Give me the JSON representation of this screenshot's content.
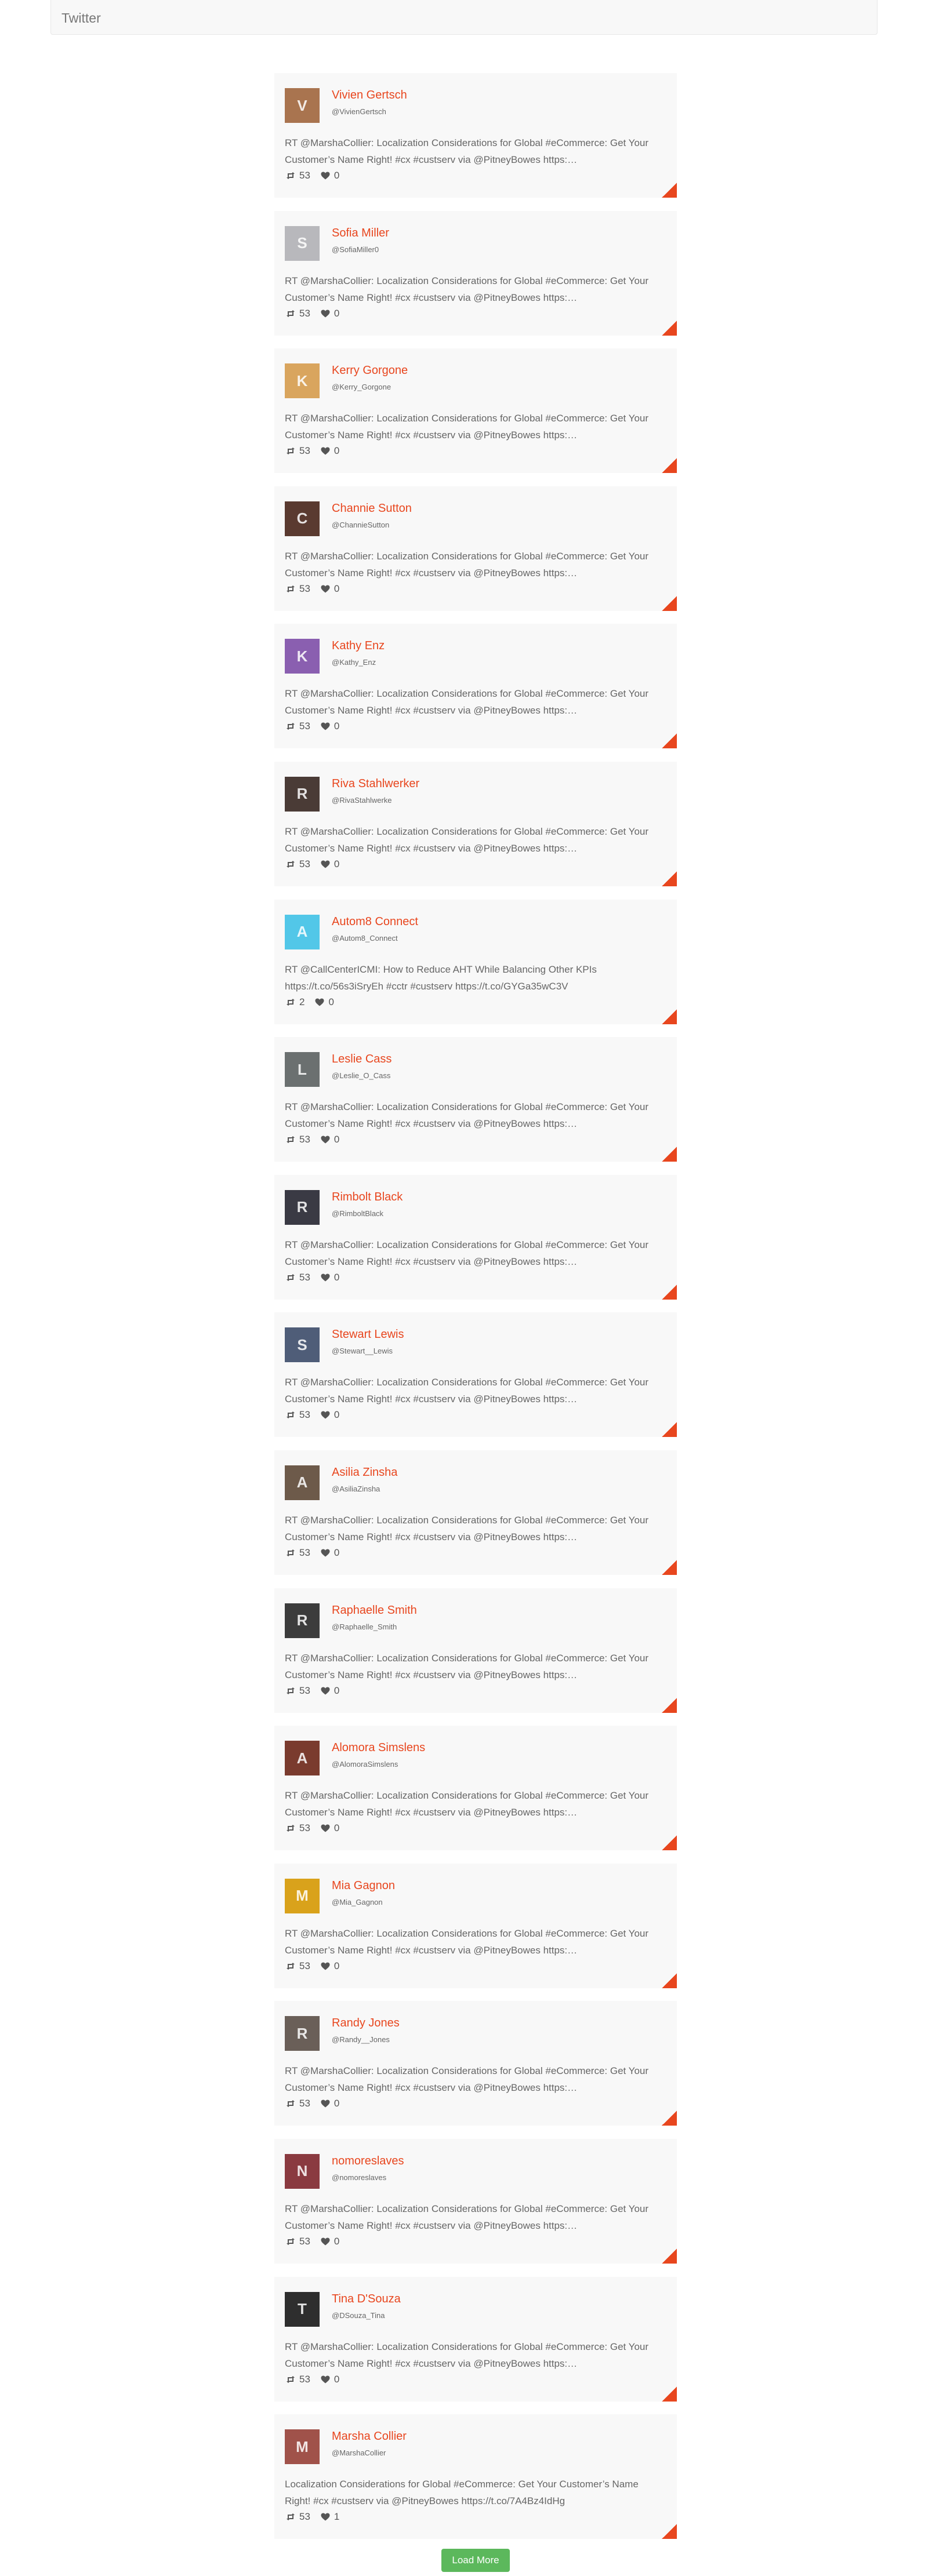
{
  "topbar": {
    "brand": "Twitter"
  },
  "colors": {
    "accent": "#e8461e",
    "button": "#5cb85c",
    "card": "#f8f8f8"
  },
  "icons": {
    "retweet": "retweet-icon",
    "like": "heart-icon",
    "corner": "corner-flag-icon"
  },
  "tweets": [
    {
      "name": "Vivien Gertsch",
      "handle": "@VivienGertsch",
      "text": "RT @MarshaCollier: Localization Considerations for Global #eCommerce: Get Your Customer’s Name Right! #cx #custserv via @PitneyBowes https:…",
      "retweets": "53",
      "likes": "0",
      "avatar_color": "#a9744f"
    },
    {
      "name": "Sofia Miller",
      "handle": "@SofiaMiller0",
      "text": "RT @MarshaCollier: Localization Considerations for Global #eCommerce: Get Your Customer’s Name Right! #cx #custserv via @PitneyBowes https:…",
      "retweets": "53",
      "likes": "0",
      "avatar_color": "#b8b8bc"
    },
    {
      "name": "Kerry Gorgone",
      "handle": "@Kerry_Gorgone",
      "text": "RT @MarshaCollier: Localization Considerations for Global #eCommerce: Get Your Customer’s Name Right! #cx #custserv via @PitneyBowes https:…",
      "retweets": "53",
      "likes": "0",
      "avatar_color": "#d9a55e"
    },
    {
      "name": "Channie Sutton",
      "handle": "@ChannieSutton",
      "text": "RT @MarshaCollier: Localization Considerations for Global #eCommerce: Get Your Customer’s Name Right! #cx #custserv via @PitneyBowes https:…",
      "retweets": "53",
      "likes": "0",
      "avatar_color": "#5a3a30"
    },
    {
      "name": "Kathy Enz",
      "handle": "@Kathy_Enz",
      "text": "RT @MarshaCollier: Localization Considerations for Global #eCommerce: Get Your Customer’s Name Right! #cx #custserv via @PitneyBowes https:…",
      "retweets": "53",
      "likes": "0",
      "avatar_color": "#8a5fb0"
    },
    {
      "name": "Riva Stahlwerker",
      "handle": "@RivaStahlwerke",
      "text": "RT @MarshaCollier: Localization Considerations for Global #eCommerce: Get Your Customer’s Name Right! #cx #custserv via @PitneyBowes https:…",
      "retweets": "53",
      "likes": "0",
      "avatar_color": "#4a3b36"
    },
    {
      "name": "Autom8 Connect",
      "handle": "@Autom8_Connect",
      "text": "RT @CallCenterICMI: How to Reduce AHT While Balancing Other KPIs https://t.co/56s3iSryEh #cctr #custserv https://t.co/GYGa35wC3V",
      "retweets": "2",
      "likes": "0",
      "avatar_color": "#52c7e8"
    },
    {
      "name": "Leslie Cass",
      "handle": "@Leslie_O_Cass",
      "text": "RT @MarshaCollier: Localization Considerations for Global #eCommerce: Get Your Customer’s Name Right! #cx #custserv via @PitneyBowes https:…",
      "retweets": "53",
      "likes": "0",
      "avatar_color": "#6b7070"
    },
    {
      "name": "Rimbolt Black",
      "handle": "@RimboltBlack",
      "text": "RT @MarshaCollier: Localization Considerations for Global #eCommerce: Get Your Customer’s Name Right! #cx #custserv via @PitneyBowes https:…",
      "retweets": "53",
      "likes": "0",
      "avatar_color": "#3a3a44"
    },
    {
      "name": "Stewart Lewis",
      "handle": "@Stewart__Lewis",
      "text": "RT @MarshaCollier: Localization Considerations for Global #eCommerce: Get Your Customer’s Name Right! #cx #custserv via @PitneyBowes https:…",
      "retweets": "53",
      "likes": "0",
      "avatar_color": "#4f5d78"
    },
    {
      "name": "Asilia Zinsha",
      "handle": "@AsiliaZinsha",
      "text": "RT @MarshaCollier: Localization Considerations for Global #eCommerce: Get Your Customer’s Name Right! #cx #custserv via @PitneyBowes https:…",
      "retweets": "53",
      "likes": "0",
      "avatar_color": "#6d5a4a"
    },
    {
      "name": "Raphaelle Smith",
      "handle": "@Raphaelle_Smith",
      "text": "RT @MarshaCollier: Localization Considerations for Global #eCommerce: Get Your Customer’s Name Right! #cx #custserv via @PitneyBowes https:…",
      "retweets": "53",
      "likes": "0",
      "avatar_color": "#3c3c3c"
    },
    {
      "name": "Alomora Simslens",
      "handle": "@AlomoraSimslens",
      "text": "RT @MarshaCollier: Localization Considerations for Global #eCommerce: Get Your Customer’s Name Right! #cx #custserv via @PitneyBowes https:…",
      "retweets": "53",
      "likes": "0",
      "avatar_color": "#7a3b2e"
    },
    {
      "name": "Mia Gagnon",
      "handle": "@Mia_Gagnon",
      "text": "RT @MarshaCollier: Localization Considerations for Global #eCommerce: Get Your Customer’s Name Right! #cx #custserv via @PitneyBowes https:…",
      "retweets": "53",
      "likes": "0",
      "avatar_color": "#d9a21b"
    },
    {
      "name": "Randy Jones",
      "handle": "@Randy__Jones",
      "text": "RT @MarshaCollier: Localization Considerations for Global #eCommerce: Get Your Customer’s Name Right! #cx #custserv via @PitneyBowes https:…",
      "retweets": "53",
      "likes": "0",
      "avatar_color": "#6a5f58"
    },
    {
      "name": "nomoreslaves",
      "handle": "@nomoreslaves",
      "text": "RT @MarshaCollier: Localization Considerations for Global #eCommerce: Get Your Customer’s Name Right! #cx #custserv via @PitneyBowes https:…",
      "retweets": "53",
      "likes": "0",
      "avatar_color": "#8a3a40"
    },
    {
      "name": "Tina D'Souza",
      "handle": "@DSouza_Tina",
      "text": "RT @MarshaCollier: Localization Considerations for Global #eCommerce: Get Your Customer’s Name Right! #cx #custserv via @PitneyBowes https:…",
      "retweets": "53",
      "likes": "0",
      "avatar_color": "#2e2e2e"
    },
    {
      "name": "Marsha Collier",
      "handle": "@MarshaCollier",
      "text": "Localization Considerations for Global #eCommerce: Get Your Customer’s Name Right! #cx #custserv via @PitneyBowes https://t.co/7A4Bz4IdHg",
      "retweets": "53",
      "likes": "1",
      "avatar_color": "#a0524a"
    }
  ],
  "load_more": {
    "label": "Load More"
  }
}
